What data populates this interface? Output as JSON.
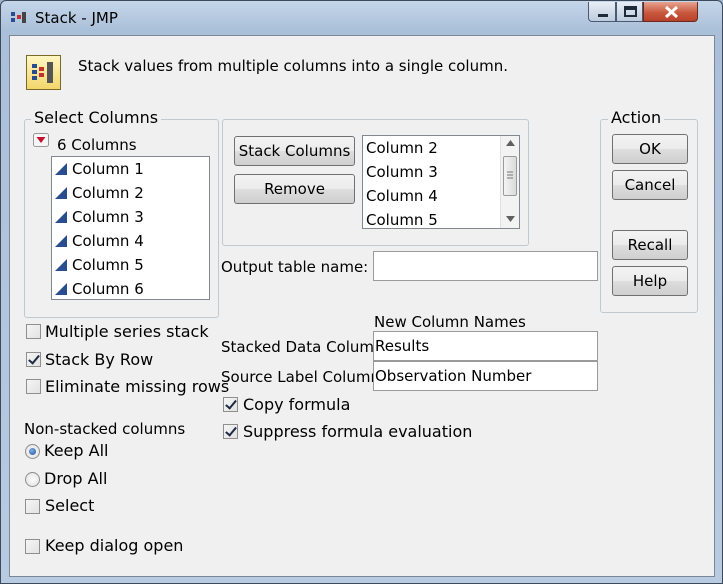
{
  "window": {
    "title": "Stack - JMP"
  },
  "header": {
    "description": "Stack values from multiple columns into a single column."
  },
  "select_columns": {
    "title": "Select Columns",
    "count_label": "6 Columns",
    "items": [
      "Column 1",
      "Column 2",
      "Column 3",
      "Column 4",
      "Column 5",
      "Column 6"
    ]
  },
  "stack_panel": {
    "stack_button": "Stack Columns",
    "remove_button": "Remove",
    "selected_items": [
      "Column 2",
      "Column 3",
      "Column 4",
      "Column 5"
    ]
  },
  "action": {
    "title": "Action",
    "ok": "OK",
    "cancel": "Cancel",
    "recall": "Recall",
    "help": "Help"
  },
  "output": {
    "label": "Output table name:",
    "value": ""
  },
  "new_column_names": {
    "heading": "New Column Names",
    "stacked_label": "Stacked Data Column",
    "stacked_value": "Results",
    "source_label": "Source Label Column",
    "source_value": "Observation Number"
  },
  "options": {
    "multiple_series_stack": {
      "label": "Multiple series stack",
      "checked": false
    },
    "stack_by_row": {
      "label": "Stack By Row",
      "checked": true
    },
    "eliminate_missing_rows": {
      "label": "Eliminate missing rows",
      "checked": false
    },
    "copy_formula": {
      "label": "Copy formula",
      "checked": true
    },
    "suppress_formula_evaluation": {
      "label": "Suppress formula evaluation",
      "checked": true
    }
  },
  "non_stacked": {
    "heading": "Non-stacked columns",
    "keep_all": {
      "label": "Keep All",
      "selected": true
    },
    "drop_all": {
      "label": "Drop All",
      "selected": false
    },
    "select": {
      "label": "Select",
      "checked": false
    }
  },
  "keep_dialog_open": {
    "label": "Keep dialog open",
    "checked": false
  },
  "colors": {
    "title_bar": "#aabfd8",
    "close_button": "#c85a3e",
    "client_bg": "#f0f0f0",
    "column_icon": "#2a4d8f"
  }
}
